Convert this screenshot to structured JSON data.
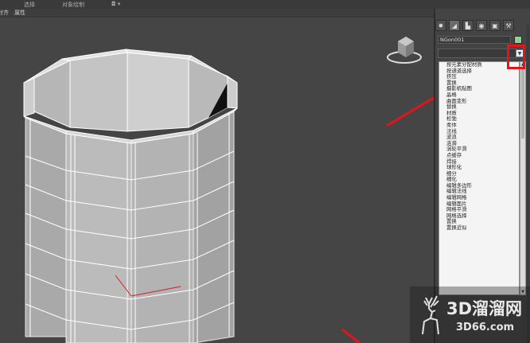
{
  "menu": {
    "select_label": "选择",
    "object_paint_label": "对象绘制",
    "menu_glyph": "◘ ▾"
  },
  "toolbar": {
    "align_label": "对齐",
    "properties_label": "属性"
  },
  "command_panel": {
    "tabs": [
      {
        "name": "create-icon",
        "glyph": "✸"
      },
      {
        "name": "modify-icon",
        "glyph": "◢"
      },
      {
        "name": "hierarchy-icon",
        "glyph": "▙"
      },
      {
        "name": "motion-icon",
        "glyph": "◉"
      },
      {
        "name": "display-icon",
        "glyph": "▣"
      },
      {
        "name": "utilities-icon",
        "glyph": "⚒"
      }
    ],
    "object_name": "NGon001",
    "object_color": "#8fd28f",
    "modifier_dropdown_arrow": "▼",
    "modifier_list": [
      "按元素分配材质",
      "按通道选择",
      "挤压",
      "置换",
      "摄影机贴图",
      "晶格",
      "曲面变形",
      "替换",
      "材质",
      "松弛",
      "柔体",
      "法线",
      "波浪",
      "涟漪",
      "涡轮平滑",
      "点缓存",
      "焊接",
      "球形化",
      "细分",
      "细化",
      "编辑多边形",
      "编辑法线",
      "编辑网格",
      "编辑面片",
      "网格平滑",
      "网格选择",
      "置换",
      "置换近似"
    ]
  },
  "watermark": {
    "main_text": "3D溜溜网",
    "sub_text": "3D66.com"
  },
  "colors": {
    "annotation_red": "#e3141a",
    "viewport_bg": "#454545",
    "mesh_fill": "#b9b9b9",
    "wire_white": "#ffffff"
  }
}
